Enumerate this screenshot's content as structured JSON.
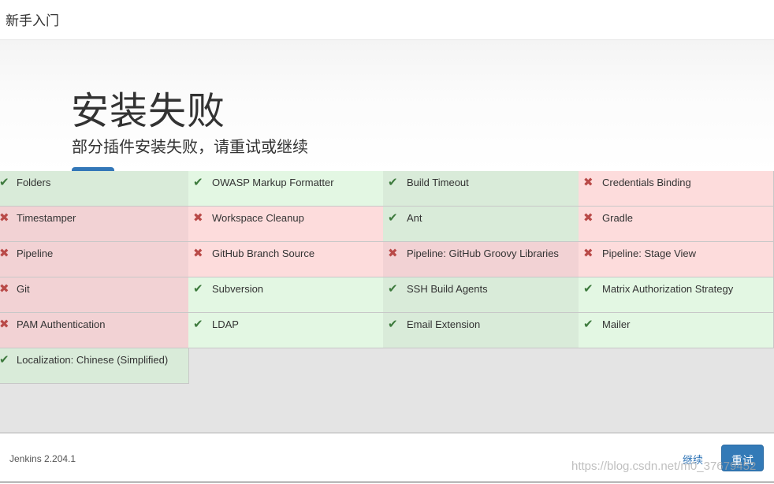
{
  "header": {
    "title": "新手入门"
  },
  "hero": {
    "title": "安装失败",
    "subtitle": "部分插件安装失败，请重试或继续"
  },
  "plugins": [
    {
      "name": "Folders",
      "status": "success"
    },
    {
      "name": "OWASP Markup Formatter",
      "status": "success"
    },
    {
      "name": "Build Timeout",
      "status": "success"
    },
    {
      "name": "Credentials Binding",
      "status": "failed"
    },
    {
      "name": "Timestamper",
      "status": "failed"
    },
    {
      "name": "Workspace Cleanup",
      "status": "failed"
    },
    {
      "name": "Ant",
      "status": "success"
    },
    {
      "name": "Gradle",
      "status": "failed"
    },
    {
      "name": "Pipeline",
      "status": "failed"
    },
    {
      "name": "GitHub Branch Source",
      "status": "failed"
    },
    {
      "name": "Pipeline: GitHub Groovy Libraries",
      "status": "failed"
    },
    {
      "name": "Pipeline: Stage View",
      "status": "failed"
    },
    {
      "name": "Git",
      "status": "failed"
    },
    {
      "name": "Subversion",
      "status": "success"
    },
    {
      "name": "SSH Build Agents",
      "status": "success"
    },
    {
      "name": "Matrix Authorization Strategy",
      "status": "success"
    },
    {
      "name": "PAM Authentication",
      "status": "failed"
    },
    {
      "name": "LDAP",
      "status": "success"
    },
    {
      "name": "Email Extension",
      "status": "success"
    },
    {
      "name": "Mailer",
      "status": "success"
    },
    {
      "name": "Localization: Chinese (Simplified)",
      "status": "success"
    }
  ],
  "icons": {
    "success": "check-icon",
    "failed": "cross-icon"
  },
  "footer": {
    "version": "Jenkins 2.204.1",
    "continue_label": "继续",
    "retry_label": "重试"
  },
  "watermark": "https://blog.csdn.net/m0_37679452",
  "colors": {
    "primary": "#337ab7",
    "success_icon": "#3d7a3d",
    "fail_icon": "#b94a48"
  }
}
